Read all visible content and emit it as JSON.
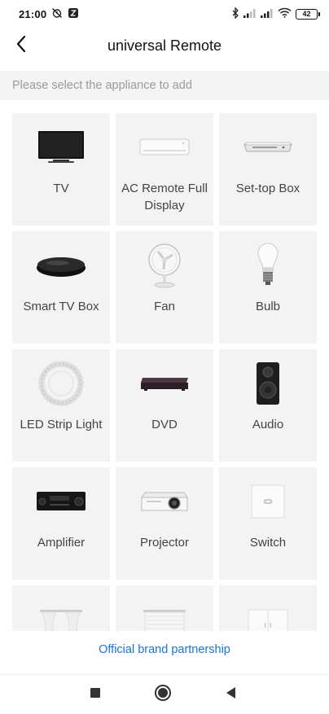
{
  "status_bar": {
    "time": "21:00",
    "battery": "42",
    "icons": [
      "alarm-off-icon",
      "app-notification-icon",
      "bluetooth-icon",
      "signal-icon",
      "signal-icon",
      "wifi-icon",
      "battery-icon"
    ]
  },
  "header": {
    "title": "universal Remote",
    "back_icon": "back-arrow-icon"
  },
  "subtitle": "Please select the appliance to add",
  "appliances": [
    {
      "label": "TV",
      "icon": "tv-icon"
    },
    {
      "label": "AC Remote Full Display",
      "icon": "air-conditioner-icon"
    },
    {
      "label": "Set-top Box",
      "icon": "set-top-box-icon"
    },
    {
      "label": "Smart TV Box",
      "icon": "smart-tv-box-icon"
    },
    {
      "label": "Fan",
      "icon": "fan-icon"
    },
    {
      "label": "Bulb",
      "icon": "bulb-icon"
    },
    {
      "label": "LED Strip Light",
      "icon": "led-strip-icon"
    },
    {
      "label": "DVD",
      "icon": "dvd-icon"
    },
    {
      "label": "Audio",
      "icon": "speaker-icon"
    },
    {
      "label": "Amplifier",
      "icon": "amplifier-icon"
    },
    {
      "label": "Projector",
      "icon": "projector-icon"
    },
    {
      "label": "Switch",
      "icon": "switch-icon"
    },
    {
      "label": "",
      "icon": "curtain-icon"
    },
    {
      "label": "",
      "icon": "blinds-icon"
    },
    {
      "label": "",
      "icon": "cabinet-icon"
    }
  ],
  "footer": {
    "link": "Official brand partnership"
  },
  "nav_bar": {
    "icons": [
      "recents-square-icon",
      "home-circle-icon",
      "back-triangle-icon"
    ]
  },
  "colors": {
    "accent": "#1a73d9",
    "tile_bg": "#f3f3f3",
    "subtitle_bg": "#f4f4f4"
  }
}
